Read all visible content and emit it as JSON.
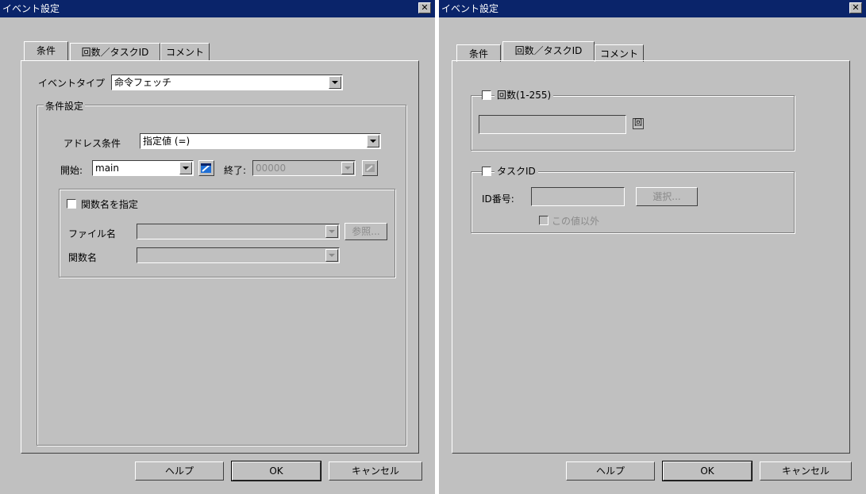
{
  "left": {
    "title": "イベント設定",
    "close_glyph": "✕",
    "tabs": [
      {
        "label": "条件"
      },
      {
        "label": "回数／タスクID"
      },
      {
        "label": "コメント"
      }
    ],
    "event_type_label": "イベントタイプ",
    "event_type_value": "命令フェッチ",
    "condition_group_label": "条件設定",
    "address_condition_label": "アドレス条件",
    "address_condition_value": "指定値 (=)",
    "start_label": "開始:",
    "start_value": "main",
    "end_label": "終了:",
    "end_value": "00000",
    "function_check_label": "関数名を指定",
    "file_name_label": "ファイル名",
    "function_name_label": "関数名",
    "browse_label": "参照...",
    "buttons": {
      "help": "ヘルプ",
      "ok": "OK",
      "cancel": "キャンセル"
    }
  },
  "right": {
    "title": "イベント設定",
    "close_glyph": "✕",
    "tabs": [
      {
        "label": "条件"
      },
      {
        "label": "回数／タスクID"
      },
      {
        "label": "コメント"
      }
    ],
    "count_check_label": "回数(1-255)",
    "count_unit": "回",
    "taskid_check_label": "タスクID",
    "id_number_label": "ID番号:",
    "select_label": "選択...",
    "except_label": "この値以外",
    "buttons": {
      "help": "ヘルプ",
      "ok": "OK",
      "cancel": "キャンセル"
    }
  },
  "colors": {
    "titlebar": "#0a246a",
    "face": "#c0c0c0",
    "accent_icon": "#1f6fd6"
  }
}
